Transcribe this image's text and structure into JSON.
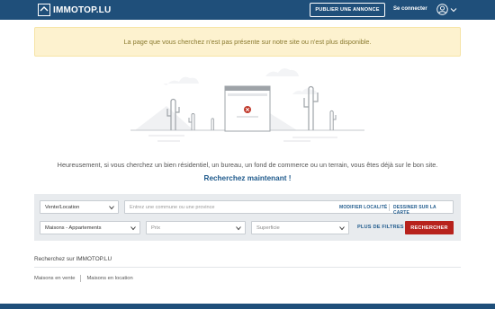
{
  "header": {
    "logo_text": "IMMOTOP.LU",
    "publish_label": "PUBLIER UNE ANNONCE",
    "login_label": "Se connecter",
    "user_icon": "user-circle-icon"
  },
  "alert": {
    "message": "La page que vous cherchez n'est pas présente sur notre site ou n'est plus disponible."
  },
  "intro": {
    "line": "Heureusement, si vous cherchez un bien résidentiel, un bureau, un fond de commerce ou un terrain, vous êtes déjà sur le bon site.",
    "cta": "Recherchez maintenant !"
  },
  "search": {
    "contract_select": "Vente/Location",
    "location_placeholder": "Entrez une commune ou une province",
    "modify_locality": "MODIFIER LOCALITÉ",
    "draw_on_map": "DESSINER SUR LA CARTE",
    "type_select": "Maisons - Appartements",
    "price_select": "Prix",
    "surface_select": "Superficie",
    "more_filters": "PLUS DE FILTRES",
    "submit": "RECHERCHER"
  },
  "bottom": {
    "search_on": "Recherchez sur IMMOTOP.LU",
    "links": [
      "Maisons en vente",
      "Maisons en location"
    ]
  },
  "colors": {
    "header_bg": "#1f4f7a",
    "accent_red": "#b7221c",
    "link_blue": "#1f5a8c",
    "alert_bg": "#fdf2cf"
  }
}
